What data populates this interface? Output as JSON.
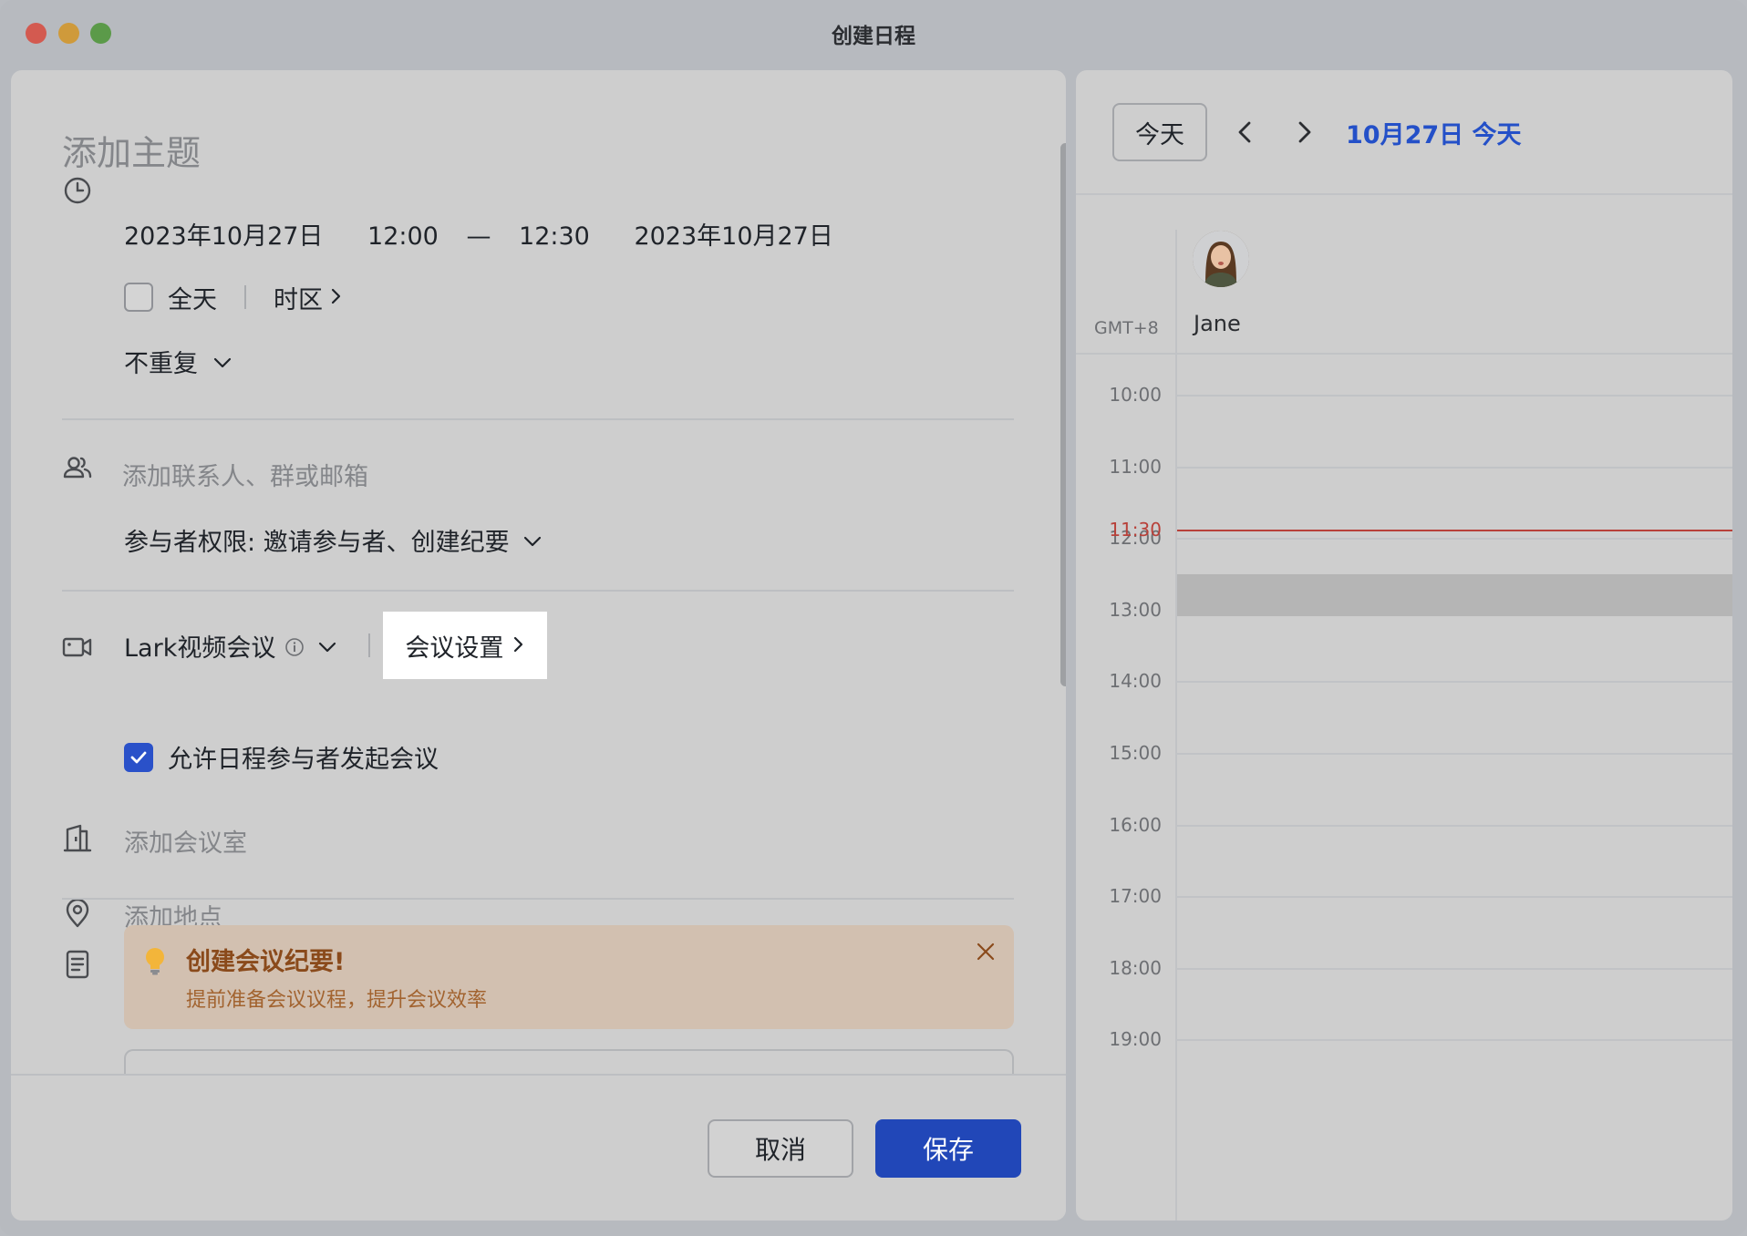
{
  "window": {
    "title": "创建日程"
  },
  "form": {
    "subject_placeholder": "添加主题",
    "start_date": "2023年10月27日",
    "start_time": "12:00",
    "dash": "—",
    "end_time": "12:30",
    "end_date": "2023年10月27日",
    "all_day_label": "全天",
    "timezone_label": "时区",
    "repeat_label": "不重复",
    "attendee_placeholder": "添加联系人、群或邮箱",
    "permission_label": "参与者权限: 邀请参与者、创建纪要",
    "video_label": "Lark视频会议",
    "meeting_settings_label": "会议设置",
    "allow_attendees_label": "允许日程参与者发起会议",
    "allow_attendees_checked": true,
    "all_day_checked": false,
    "room_placeholder": "添加会议室",
    "location_placeholder": "添加地点",
    "tip_title": "创建会议纪要!",
    "tip_subtitle": "提前准备会议议程，提升会议效率"
  },
  "footer": {
    "cancel_label": "取消",
    "save_label": "保存"
  },
  "calendar": {
    "today_button": "今天",
    "date_label": "10月27日 今天",
    "timezone": "GMT+8",
    "person": "Jane",
    "now_time": "11:30",
    "hours": [
      "10:00",
      "11:00",
      "12:00",
      "13:00",
      "14:00",
      "15:00",
      "16:00",
      "17:00",
      "18:00",
      "19:00"
    ]
  },
  "colors": {
    "accent": "#2147b8",
    "now_line": "#b8413a",
    "tip_bg": "#d2c0b0",
    "tip_text": "#8a4a1b"
  }
}
